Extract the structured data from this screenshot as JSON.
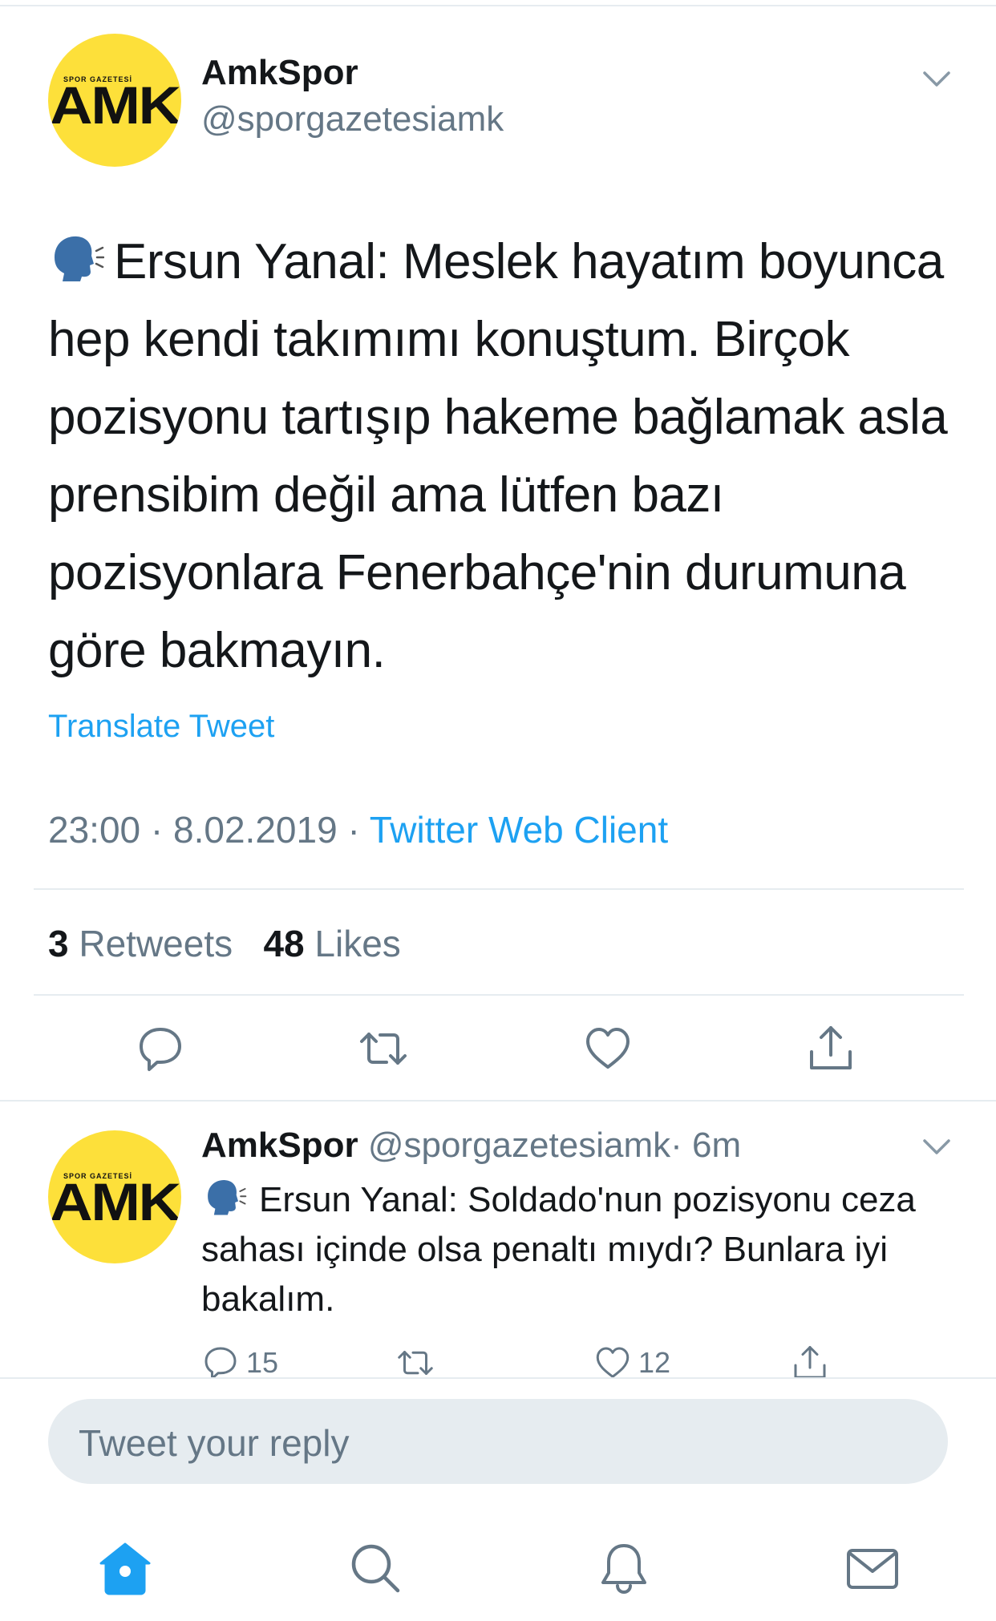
{
  "tweet": {
    "author_name": "AmkSpor",
    "author_handle": "@sporgazetesiamk",
    "avatar_small_text": "SPOR GAZETESİ",
    "avatar_big_text": "AMK",
    "text": "Ersun Yanal: Meslek hayatım boyunca hep kendi takımımı konuştum. Birçok pozisyonu tartışıp hakeme bağlamak asla prensibim değil ama lütfen bazı pozisyonlara Fenerbahçe'nin durumuna göre bakmayın.",
    "translate_label": "Translate Tweet",
    "time": "23:00",
    "date": "8.02.2019",
    "separator": "·",
    "source": "Twitter Web Client",
    "retweets_count": "3",
    "retweets_label": "Retweets",
    "likes_count": "48",
    "likes_label": "Likes"
  },
  "reply": {
    "author_name": "AmkSpor",
    "author_handle": "@sporgazetesiamk",
    "age": "· 6m",
    "text": "Ersun Yanal: Soldado'nun pozisyonu ceza sahası içinde olsa penaltı mıydı? Bunlara iyi bakalım.",
    "reply_count": "15",
    "like_count": "12"
  },
  "compose": {
    "placeholder": "Tweet your reply"
  },
  "icons": {
    "speaking_head": "speaking-head-emoji",
    "more": "chevron-down-icon",
    "reply": "reply-icon",
    "retweet": "retweet-icon",
    "like": "heart-icon",
    "share": "share-icon",
    "home": "home-icon",
    "search": "search-icon",
    "notifications": "bell-icon",
    "messages": "envelope-icon"
  },
  "colors": {
    "accent": "#1da1f2",
    "secondary_text": "#657786",
    "avatar_yellow": "#fde03a",
    "divider": "#e6ecf0"
  }
}
